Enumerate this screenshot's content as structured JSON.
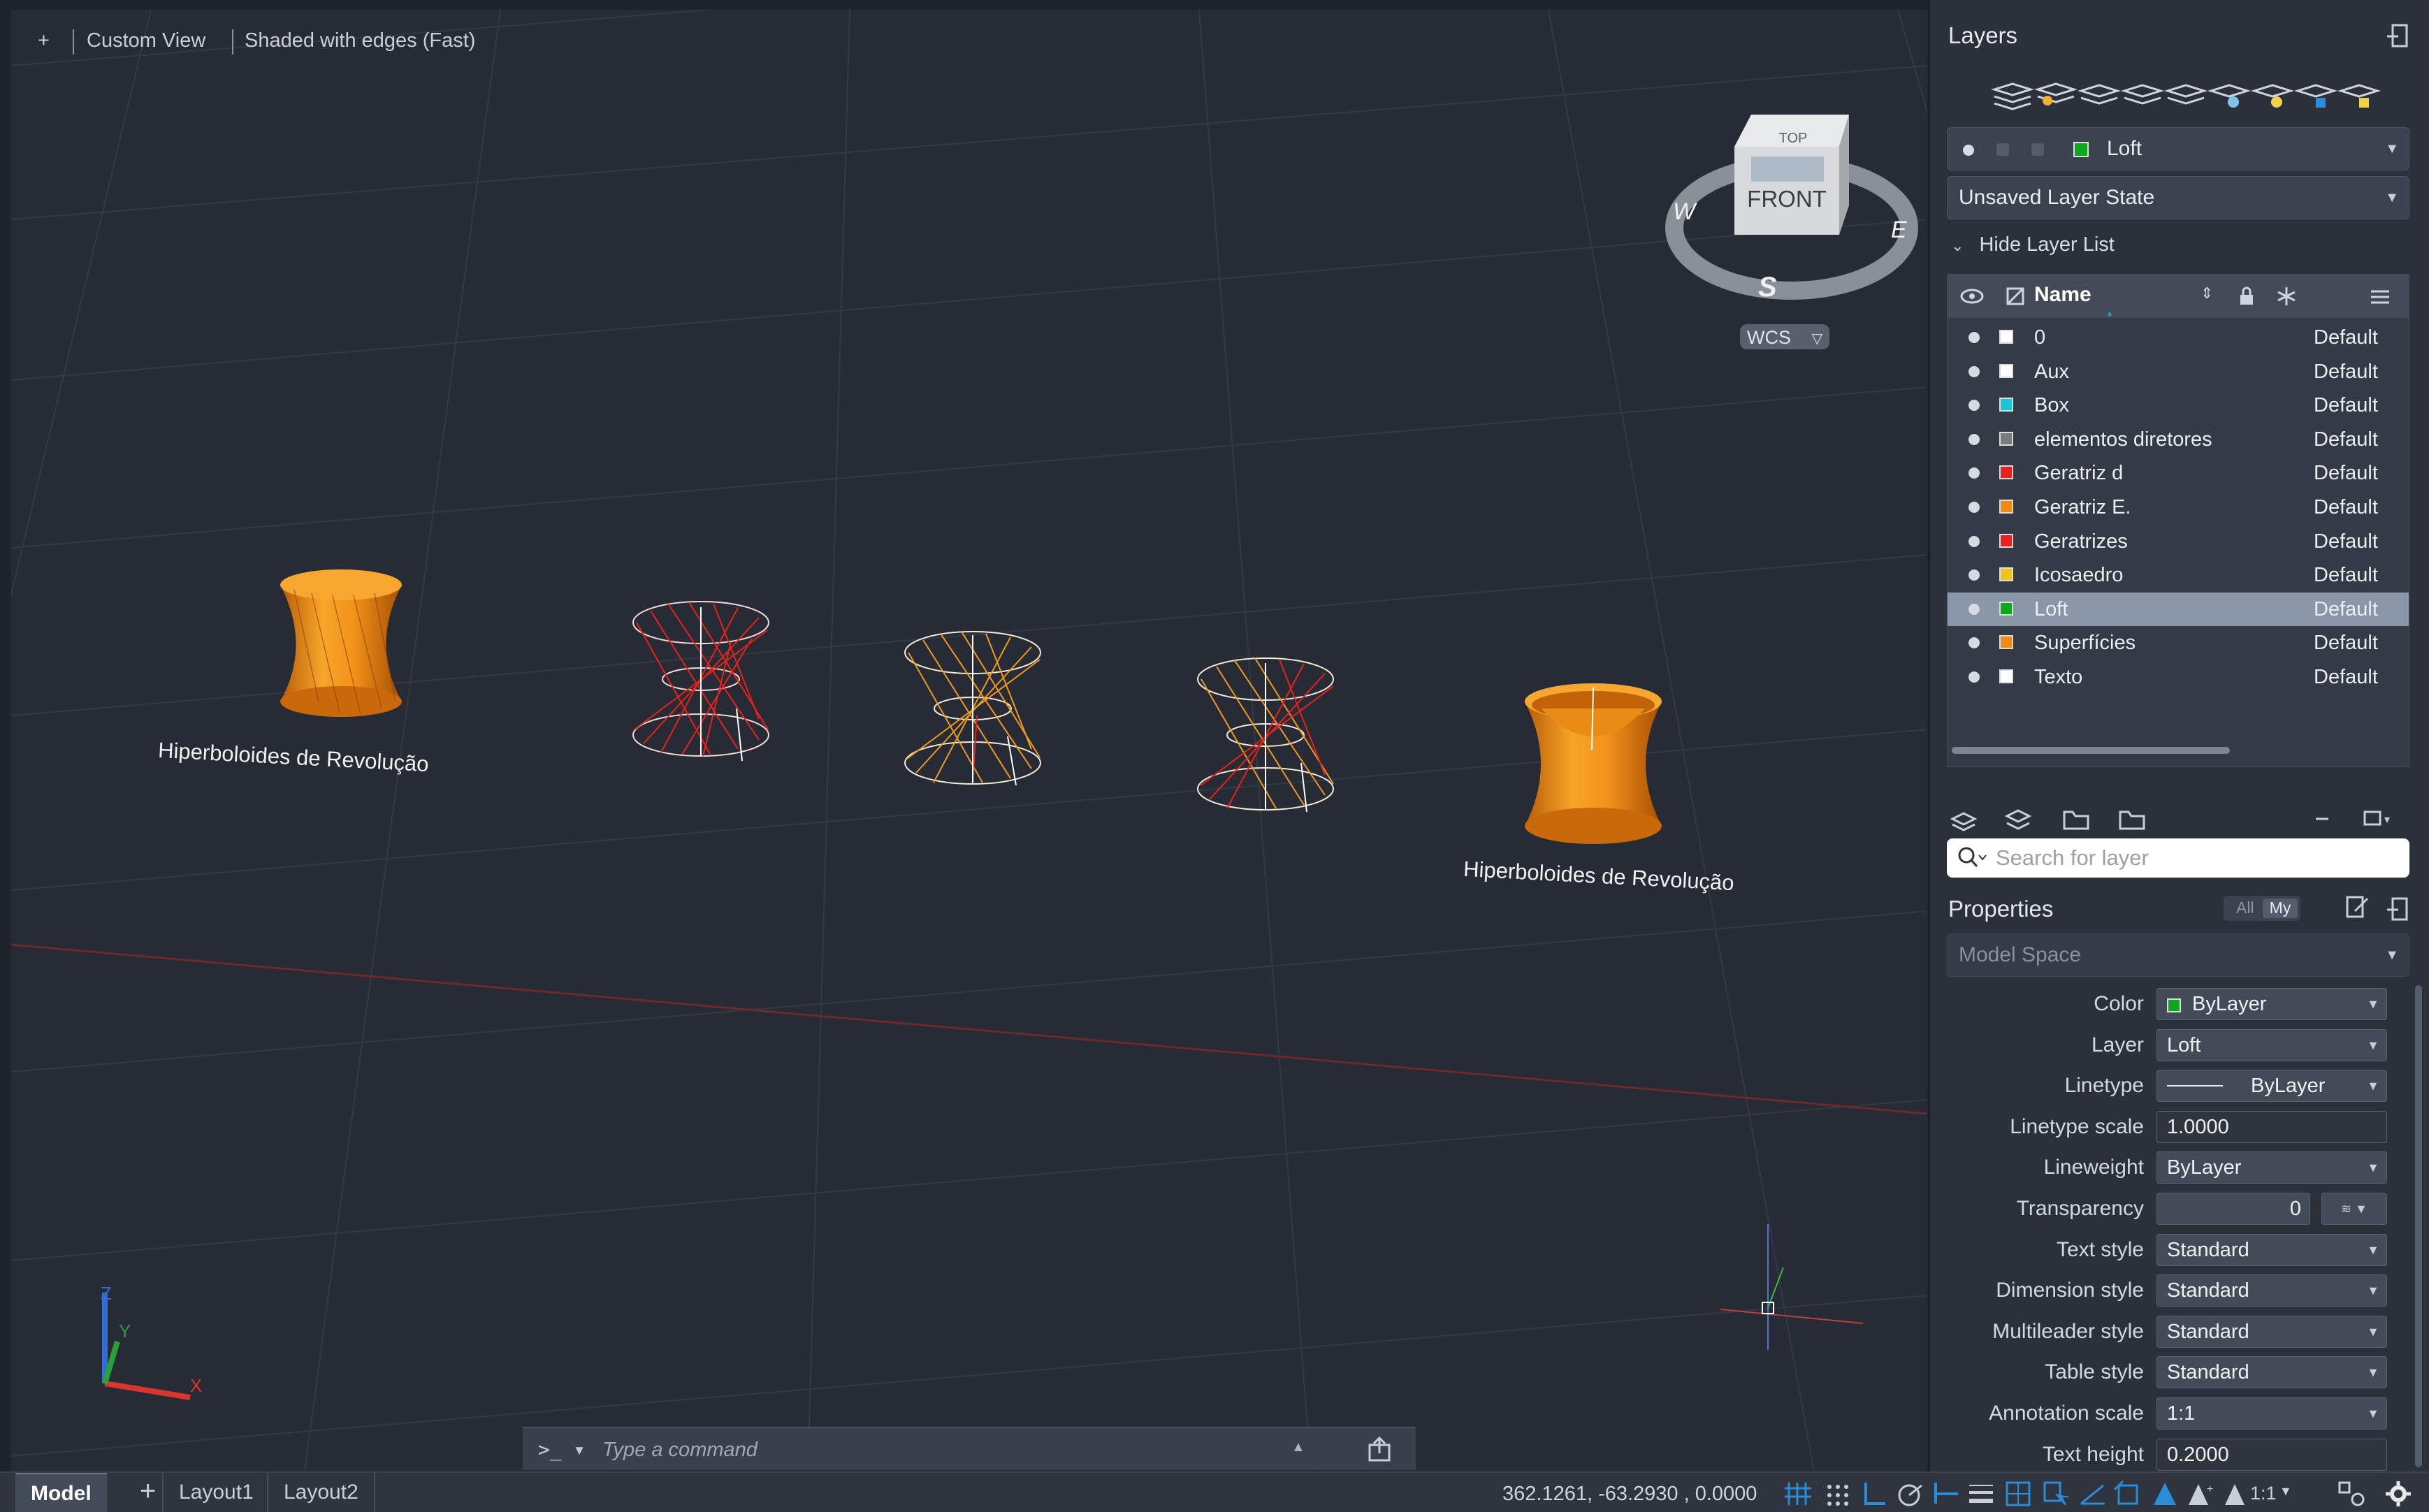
{
  "viewport": {
    "plus": "+",
    "view_name": "Custom View",
    "visual_style": "Shaded with edges (Fast)",
    "labels": [
      "Hiperboloides de Revolução",
      "Hiperboloides de Revolução"
    ],
    "viewcube": {
      "top": "TOP",
      "front": "FRONT",
      "w": "W",
      "e": "E",
      "s": "S"
    },
    "wcs": "WCS"
  },
  "command": {
    "prompt": ">_",
    "placeholder": "Type a command"
  },
  "status": {
    "tabs": [
      "Model",
      "+",
      "Layout1",
      "Layout2"
    ],
    "coords": "362.1261, -63.2930 , 0.0000",
    "annotation_scale": "1:1"
  },
  "layers": {
    "title": "Layers",
    "current_layer": "Loft",
    "layer_state": "Unsaved Layer State",
    "hide_list": "Hide Layer List",
    "header_name": "Name",
    "items": [
      {
        "name": "0",
        "color": "#ffffff",
        "style": "Default"
      },
      {
        "name": "Aux",
        "color": "#ffffff",
        "style": "Default"
      },
      {
        "name": "Box",
        "color": "#19c6d8",
        "style": "Default"
      },
      {
        "name": "elementos diretores",
        "color": "#7a7a7a",
        "style": "Default"
      },
      {
        "name": "Geratriz d",
        "color": "#e8221a",
        "style": "Default"
      },
      {
        "name": "Geratriz E.",
        "color": "#f28a14",
        "style": "Default"
      },
      {
        "name": "Geratrizes",
        "color": "#e8221a",
        "style": "Default"
      },
      {
        "name": "Icosaedro",
        "color": "#f3c318",
        "style": "Default"
      },
      {
        "name": "Loft",
        "color": "#0fa81d",
        "style": "Default"
      },
      {
        "name": "Superfícies",
        "color": "#f28a14",
        "style": "Default"
      },
      {
        "name": "Texto",
        "color": "#ffffff",
        "style": "Default"
      }
    ],
    "selected_index": 8,
    "search_placeholder": "Search for layer"
  },
  "properties": {
    "title": "Properties",
    "filter_all": "All",
    "filter_my": "My",
    "scope": "Model Space",
    "rows": [
      {
        "label": "Color",
        "value": "ByLayer",
        "kind": "select",
        "swatch": "#0fa81d"
      },
      {
        "label": "Layer",
        "value": "Loft",
        "kind": "select"
      },
      {
        "label": "Linetype",
        "value": "ByLayer",
        "kind": "select",
        "line": true
      },
      {
        "label": "Linetype scale",
        "value": "1.0000",
        "kind": "input"
      },
      {
        "label": "Lineweight",
        "value": "ByLayer",
        "kind": "select"
      },
      {
        "label": "Transparency",
        "value": "0",
        "kind": "slider"
      },
      {
        "label": "Text style",
        "value": "Standard",
        "kind": "select"
      },
      {
        "label": "Dimension style",
        "value": "Standard",
        "kind": "select"
      },
      {
        "label": "Multileader style",
        "value": "Standard",
        "kind": "select"
      },
      {
        "label": "Table style",
        "value": "Standard",
        "kind": "select"
      },
      {
        "label": "Annotation scale",
        "value": "1:1",
        "kind": "select"
      },
      {
        "label": "Text height",
        "value": "0.2000",
        "kind": "input"
      }
    ]
  },
  "colors": {
    "accent": "#2b8cd8",
    "orange_surface": "#f29a1c",
    "red_wire": "#e8221a"
  }
}
